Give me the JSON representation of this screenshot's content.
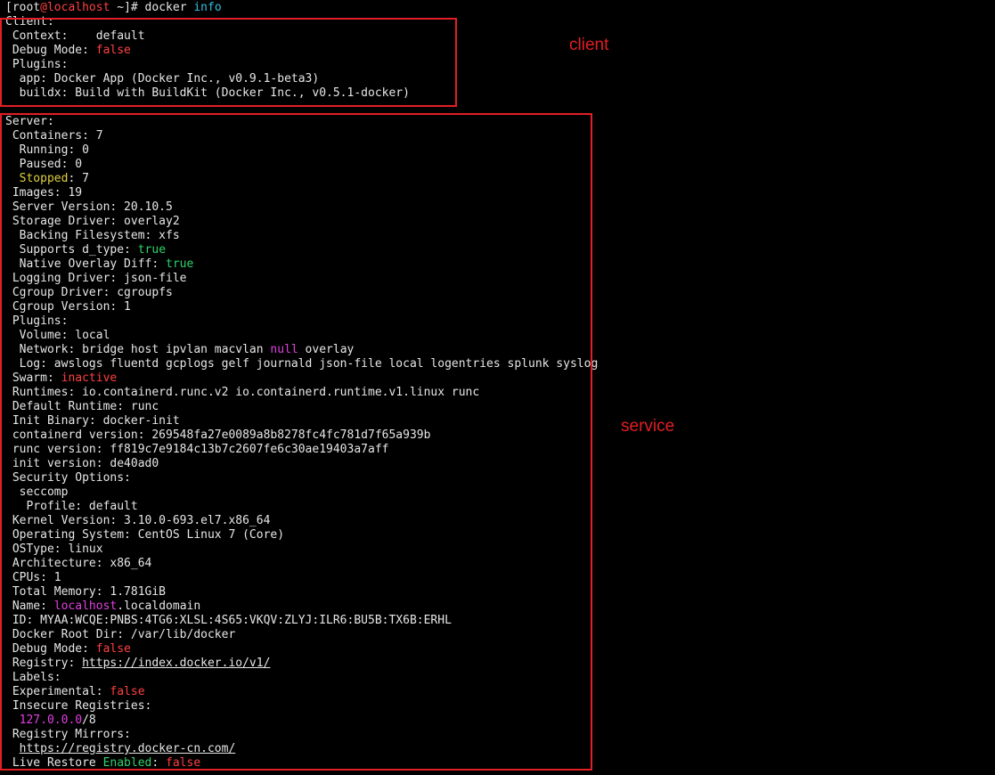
{
  "prompt": {
    "open": "[",
    "user": "root",
    "at": "@",
    "host": "localhost",
    "rest": " ~]# docker ",
    "arg": "info"
  },
  "client": {
    "header": "Client:",
    "context": {
      "key": " Context:    ",
      "value": "default"
    },
    "debug": {
      "key": " Debug Mode: ",
      "value": "false"
    },
    "plugins_header": " Plugins:",
    "plugin_app": "  app: Docker App (Docker Inc., v0.9.1-beta3)",
    "plugin_buildx": "  buildx: Build with BuildKit (Docker Inc., v0.5.1-docker)"
  },
  "server": {
    "header": "Server:",
    "containers": " Containers: 7",
    "running": "  Running: 0",
    "paused": "  Paused: 0",
    "stopped": {
      "pre": "  ",
      "key": "Stopped",
      "rest": ": 7"
    },
    "images": " Images: 19",
    "server_version": " Server Version: 20.10.5",
    "storage_driver": " Storage Driver: overlay2",
    "backing_fs": "  Backing Filesystem: xfs",
    "d_type": {
      "key": "  Supports d_type: ",
      "value": "true"
    },
    "native_overlay": {
      "key": "  Native Overlay Diff: ",
      "value": "true"
    },
    "logging_driver": " Logging Driver: json-file",
    "cgroup_driver": " Cgroup Driver: cgroupfs",
    "cgroup_version": " Cgroup Version: 1",
    "plugins_header": " Plugins:",
    "volume": "  Volume: local",
    "network": {
      "pre": "  Network: bridge host ipvlan macvlan ",
      "null": "null",
      "post": " overlay"
    },
    "log": "  Log: awslogs fluentd gcplogs gelf journald json-file local logentries splunk syslog",
    "swarm": {
      "key": " Swarm: ",
      "value": "inactive"
    },
    "runtimes": " Runtimes: io.containerd.runc.v2 io.containerd.runtime.v1.linux runc",
    "default_runtime": " Default Runtime: runc",
    "init_binary": " Init Binary: docker-init",
    "containerd_version": " containerd version: 269548fa27e0089a8b8278fc4fc781d7f65a939b",
    "runc_version": " runc version: ff819c7e9184c13b7c2607fe6c30ae19403a7aff",
    "init_version": " init version: de40ad0",
    "security_options": " Security Options:",
    "seccomp": "  seccomp",
    "profile": "   Profile: default",
    "kernel": " Kernel Version: 3.10.0-693.el7.x86_64",
    "os": " Operating System: CentOS Linux 7 (Core)",
    "ostype": " OSType: linux",
    "arch": " Architecture: x86_64",
    "cpus": " CPUs: 1",
    "memory": " Total Memory: 1.781GiB",
    "name": {
      "key": " Name: ",
      "host": "localhost",
      "rest": ".localdomain"
    },
    "id": " ID: MYAA:WCQE:PNBS:4TG6:XLSL:4S65:VKQV:ZLYJ:ILR6:BU5B:TX6B:ERHL",
    "root_dir": " Docker Root Dir: /var/lib/docker",
    "debug": {
      "key": " Debug Mode: ",
      "value": "false"
    },
    "registry": {
      "key": " Registry: ",
      "value": "https://index.docker.io/v1/"
    },
    "labels": " Labels:",
    "experimental": {
      "key": " Experimental: ",
      "value": "false"
    },
    "insecure_header": " Insecure Registries:",
    "insecure_value": {
      "pre": "  ",
      "ip": "127.0.0.0",
      "rest": "/8"
    },
    "mirrors_header": " Registry Mirrors:",
    "mirror": {
      "pre": "  ",
      "value": "https://registry.docker-cn.com/"
    },
    "live_restore": {
      "pre": " Live Restore ",
      "enabled": "Enabled",
      "colon": ": ",
      "value": "false"
    }
  },
  "annotations": {
    "client_label": "client",
    "service_label": "service",
    "box_color": "#e31e24"
  },
  "colors": {
    "background": "#000000",
    "text": "#e6e6e6",
    "red": "#ff4040",
    "cyan": "#31c0e0",
    "magenta": "#e040e0",
    "green": "#2ed36a",
    "yellow": "#e0d040"
  }
}
